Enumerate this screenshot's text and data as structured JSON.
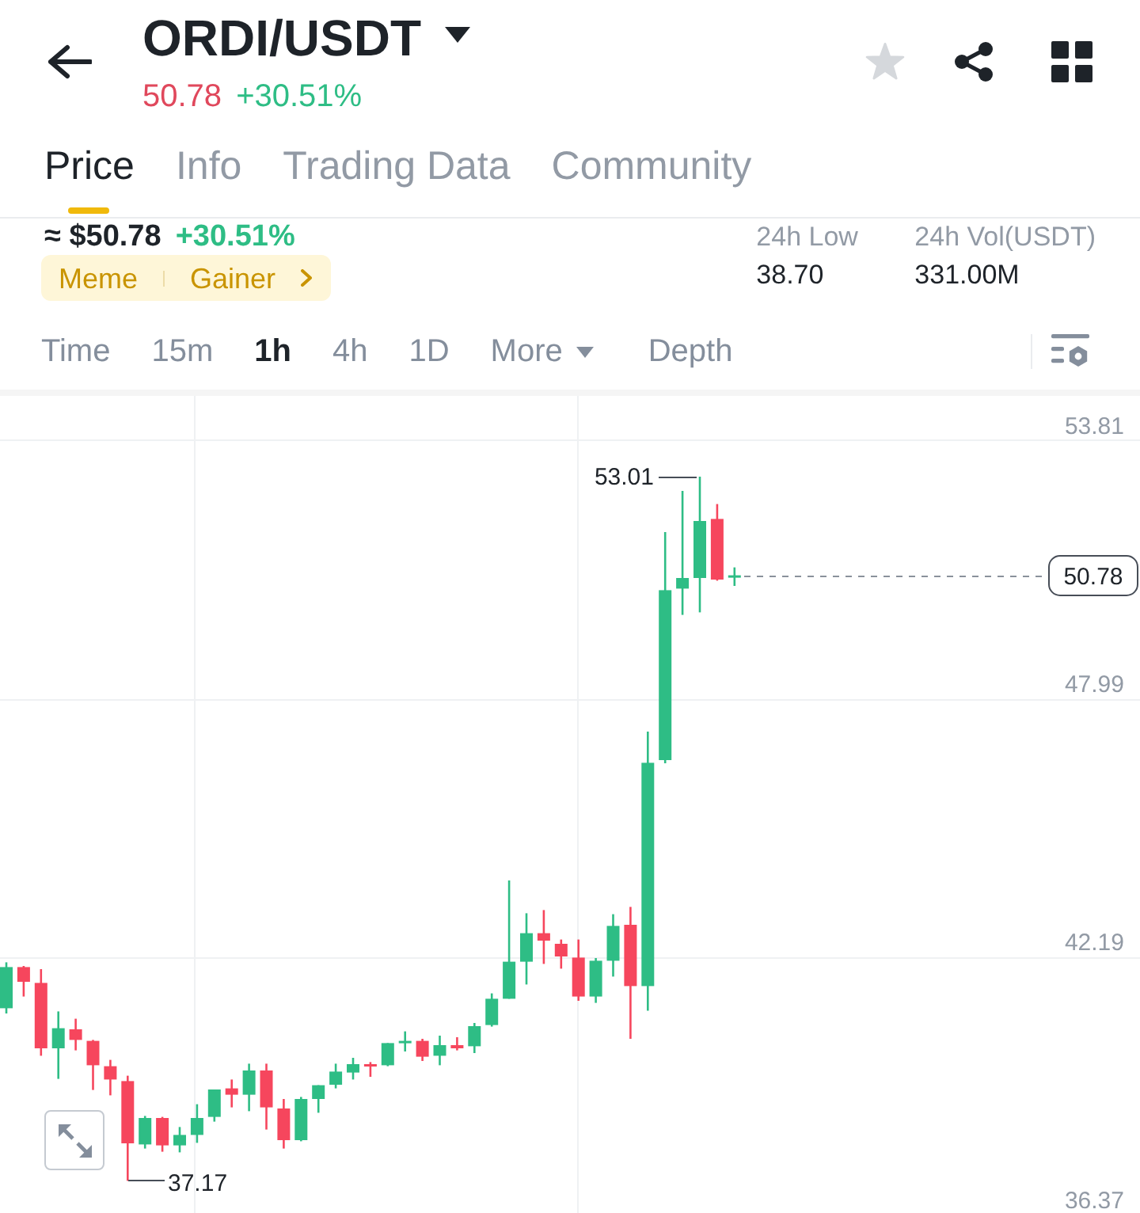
{
  "header": {
    "title": "ORDI/USDT",
    "price": "50.78",
    "change": "+30.51%",
    "favorited": false
  },
  "tabs": [
    {
      "label": "Price",
      "selected": true
    },
    {
      "label": "Info",
      "selected": false
    },
    {
      "label": "Trading Data",
      "selected": false
    },
    {
      "label": "Community",
      "selected": false
    }
  ],
  "summary": {
    "price": "≈ $50.78",
    "change": "+30.51%",
    "tags": [
      "Meme",
      "Gainer"
    ],
    "stats": [
      {
        "label": "24h Low",
        "value": "38.70"
      },
      {
        "label": "24h Vol(USDT)",
        "value": "331.00M"
      }
    ]
  },
  "intervals": [
    {
      "label": "Time",
      "kind": "option",
      "selected": false
    },
    {
      "label": "15m",
      "kind": "option",
      "selected": false
    },
    {
      "label": "1h",
      "kind": "option",
      "selected": true
    },
    {
      "label": "4h",
      "kind": "option",
      "selected": false
    },
    {
      "label": "1D",
      "kind": "option",
      "selected": false
    },
    {
      "label": "More",
      "kind": "dropdown",
      "selected": false
    },
    {
      "label": "Depth",
      "kind": "view",
      "selected": false
    }
  ],
  "chart": {
    "axis_labels": [
      "53.81",
      "47.99",
      "42.19",
      "36.37"
    ],
    "high_label": "53.01",
    "low_label": "37.17",
    "last_price": "50.78"
  }
}
